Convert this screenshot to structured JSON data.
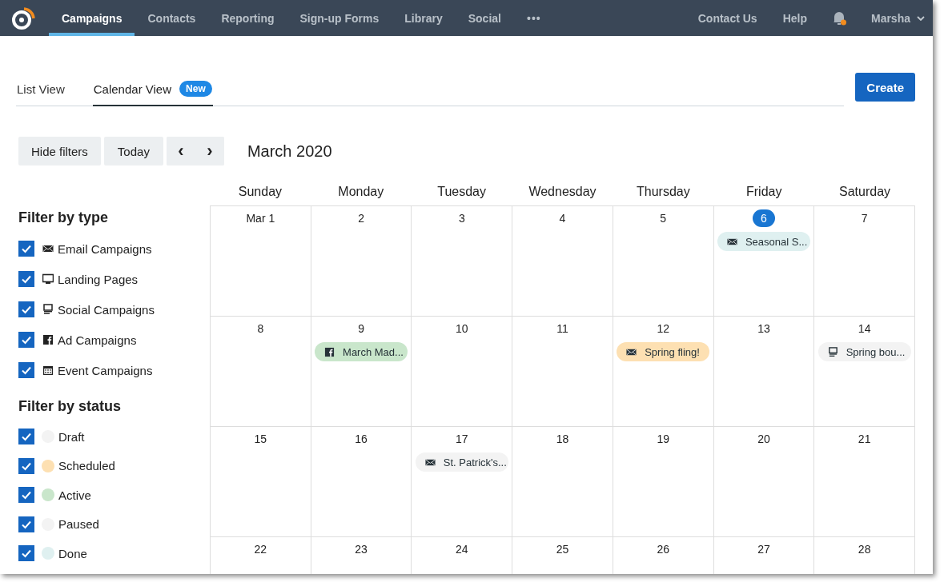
{
  "nav": {
    "items": [
      {
        "label": "Campaigns",
        "selected": true
      },
      {
        "label": "Contacts",
        "selected": false
      },
      {
        "label": "Reporting",
        "selected": false
      },
      {
        "label": "Sign-up Forms",
        "selected": false
      },
      {
        "label": "Library",
        "selected": false
      },
      {
        "label": "Social",
        "selected": false
      }
    ],
    "more": "•••",
    "right": [
      "Contact Us",
      "Help"
    ],
    "notification": true,
    "user": "Marsha"
  },
  "view_tabs": [
    {
      "label": "List View",
      "selected": false
    },
    {
      "label": "Calendar View",
      "selected": true,
      "badge": "New"
    }
  ],
  "create_button": "Create",
  "toolbar": {
    "buttons": [
      "Hide filters",
      "Today"
    ],
    "prev": "‹",
    "next": "›",
    "month": "March 2020"
  },
  "filters": {
    "type_title": "Filter by type",
    "types": [
      {
        "label": "Email Campaigns",
        "kind": "email",
        "checked": true
      },
      {
        "label": "Landing Pages",
        "kind": "landing",
        "checked": true
      },
      {
        "label": "Social Campaigns",
        "kind": "social",
        "checked": true
      },
      {
        "label": "Ad Campaigns",
        "kind": "facebook",
        "checked": true
      },
      {
        "label": "Event Campaigns",
        "kind": "event",
        "checked": true
      }
    ],
    "status_title": "Filter by status",
    "statuses": [
      {
        "label": "Draft",
        "color": "#f3f3f3",
        "checked": true
      },
      {
        "label": "Scheduled",
        "color": "#fde0b2",
        "checked": true
      },
      {
        "label": "Active",
        "color": "#c9e6cb",
        "checked": true
      },
      {
        "label": "Paused",
        "color": "#f3f3f3",
        "checked": true
      },
      {
        "label": "Done",
        "color": "#dff0f0",
        "checked": true
      }
    ]
  },
  "calendar": {
    "weekdays": [
      "Sunday",
      "Monday",
      "Tuesday",
      "Wednesday",
      "Thursday",
      "Friday",
      "Saturday"
    ],
    "weeks": [
      [
        {
          "label": "Mar 1",
          "today": false
        },
        {
          "label": "2",
          "today": false
        },
        {
          "label": "3",
          "today": false
        },
        {
          "label": "4",
          "today": false
        },
        {
          "label": "5",
          "today": false
        },
        {
          "label": "6",
          "today": true,
          "events": [
            {
              "kind": "email",
              "title": "Seasonal S...",
              "color": "#dff0f0"
            }
          ]
        },
        {
          "label": "7",
          "today": false
        }
      ],
      [
        {
          "label": "8",
          "today": false
        },
        {
          "label": "9",
          "today": false,
          "events": [
            {
              "kind": "facebook",
              "title": "March Mad...",
              "color": "#c9e6cb"
            }
          ]
        },
        {
          "label": "10",
          "today": false
        },
        {
          "label": "11",
          "today": false
        },
        {
          "label": "12",
          "today": false,
          "events": [
            {
              "kind": "email",
              "title": "Spring fling!",
              "color": "#fde0b2"
            }
          ]
        },
        {
          "label": "13",
          "today": false
        },
        {
          "label": "14",
          "today": false,
          "events": [
            {
              "kind": "social",
              "title": "Spring bou...",
              "color": "#f3f3f3"
            }
          ]
        }
      ],
      [
        {
          "label": "15",
          "today": false
        },
        {
          "label": "16",
          "today": false
        },
        {
          "label": "17",
          "today": false,
          "events": [
            {
              "kind": "email",
              "title": "St. Patrick's...",
              "color": "#f3f3f3"
            }
          ]
        },
        {
          "label": "18",
          "today": false
        },
        {
          "label": "19",
          "today": false
        },
        {
          "label": "20",
          "today": false
        },
        {
          "label": "21",
          "today": false
        }
      ],
      [
        {
          "label": "22",
          "today": false
        },
        {
          "label": "23",
          "today": false
        },
        {
          "label": "24",
          "today": false
        },
        {
          "label": "25",
          "today": false
        },
        {
          "label": "26",
          "today": false
        },
        {
          "label": "27",
          "today": false
        },
        {
          "label": "28",
          "today": false
        }
      ]
    ]
  }
}
